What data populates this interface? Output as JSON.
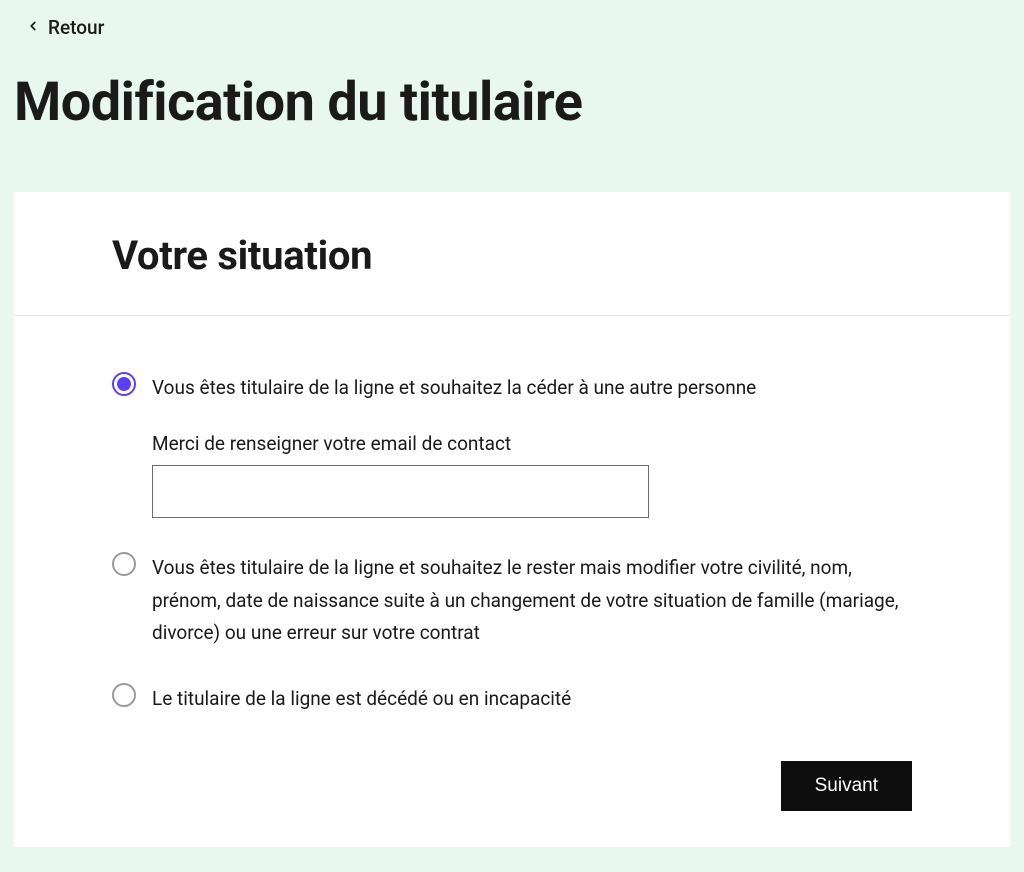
{
  "back": {
    "label": "Retour"
  },
  "page": {
    "title": "Modification du titulaire"
  },
  "card": {
    "title": "Votre situation"
  },
  "options": [
    {
      "label": "Vous êtes titulaire de la ligne et souhaitez la céder à une autre personne",
      "selected": true,
      "email": {
        "label": "Merci de renseigner votre email de contact",
        "value": ""
      }
    },
    {
      "label": "Vous êtes titulaire de la ligne et souhaitez le rester mais modifier votre civilité, nom, prénom, date de naissance suite à un changement de votre situation de famille (mariage, divorce) ou une erreur sur votre contrat",
      "selected": false
    },
    {
      "label": "Le titulaire de la ligne est décédé ou en incapacité",
      "selected": false
    }
  ],
  "actions": {
    "next": "Suivant"
  }
}
